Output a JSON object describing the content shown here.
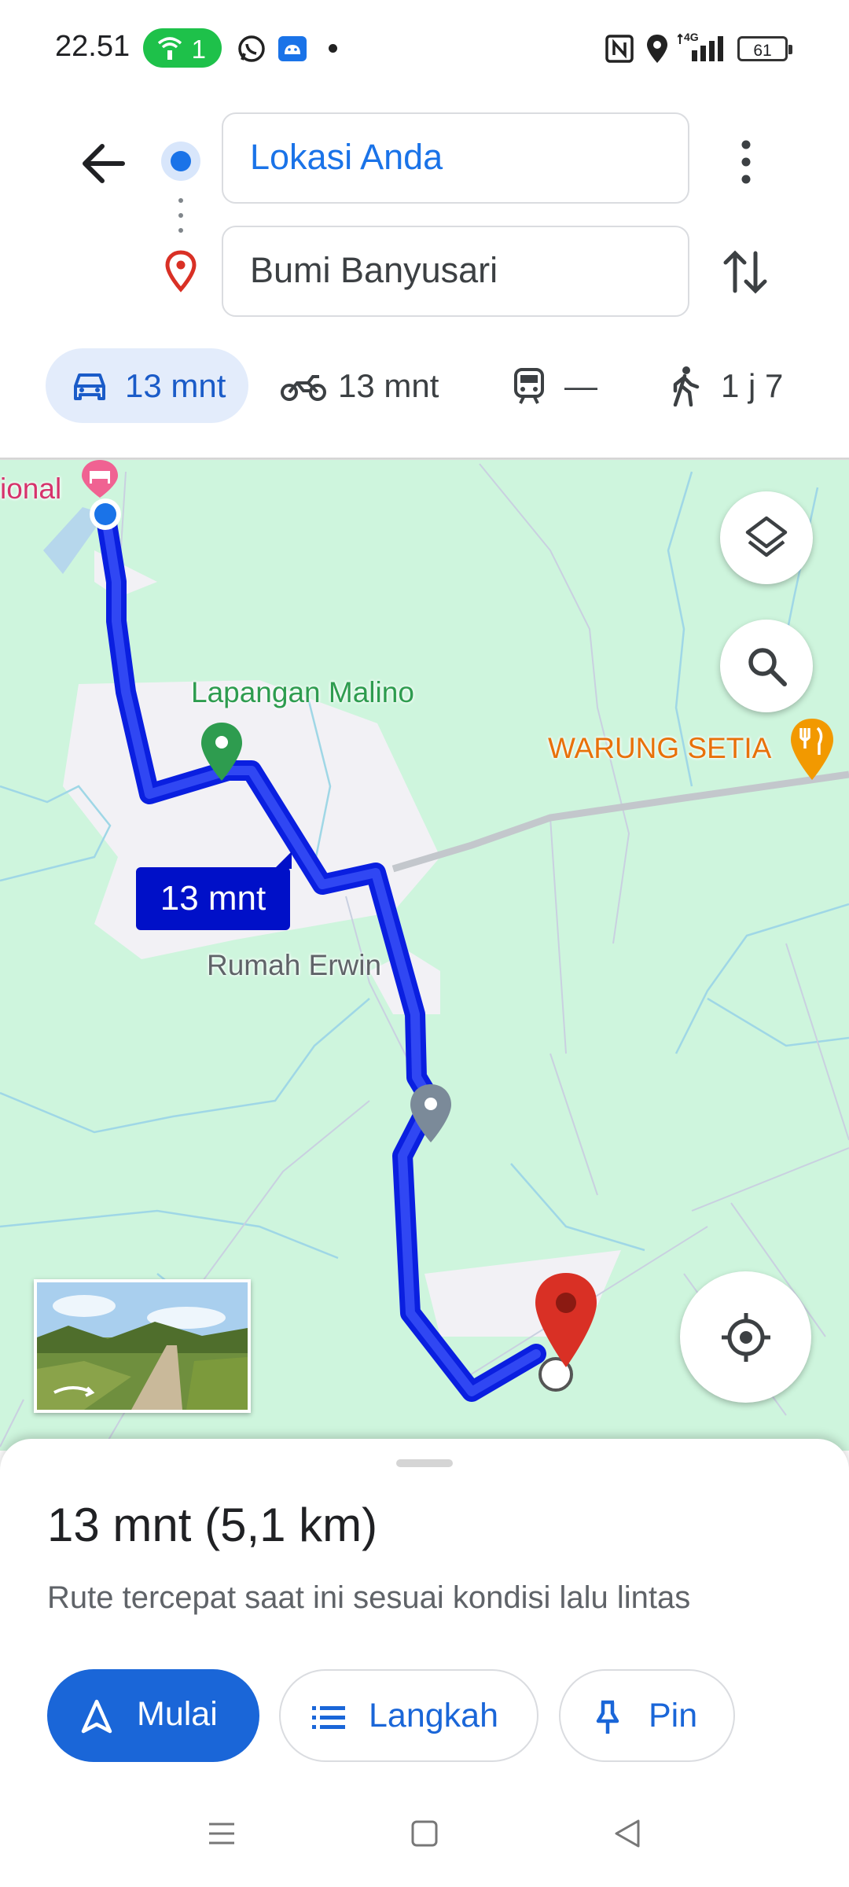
{
  "status_bar": {
    "time": "22.51",
    "hotspot_count": "1",
    "battery": "61",
    "network": "4G"
  },
  "header": {
    "origin": "Lokasi Anda",
    "destination": "Bumi Banyusari"
  },
  "modes": [
    {
      "name": "car",
      "label": "13 mnt",
      "selected": true
    },
    {
      "name": "motorcycle",
      "label": "13 mnt"
    },
    {
      "name": "transit",
      "label": "—"
    },
    {
      "name": "walk",
      "label": "1 j 7"
    }
  ],
  "map": {
    "labels": {
      "hotel": "ional",
      "field": "Lapangan Malino",
      "warung": "WARUNG SETIA",
      "house": "Rumah Erwin"
    },
    "eta_chip": "13 mnt",
    "colors": {
      "route": "#0a1fe0",
      "land": "#cef5dd",
      "destination_pin": "#d93025",
      "field_pin": "#2e9c4f",
      "warung": "#e8710a"
    }
  },
  "route": {
    "summary": "13 mnt (5,1 km)",
    "description": "Rute tercepat saat ini sesuai kondisi lalu lintas"
  },
  "actions": {
    "start": "Mulai",
    "steps": "Langkah",
    "pin": "Pin"
  }
}
